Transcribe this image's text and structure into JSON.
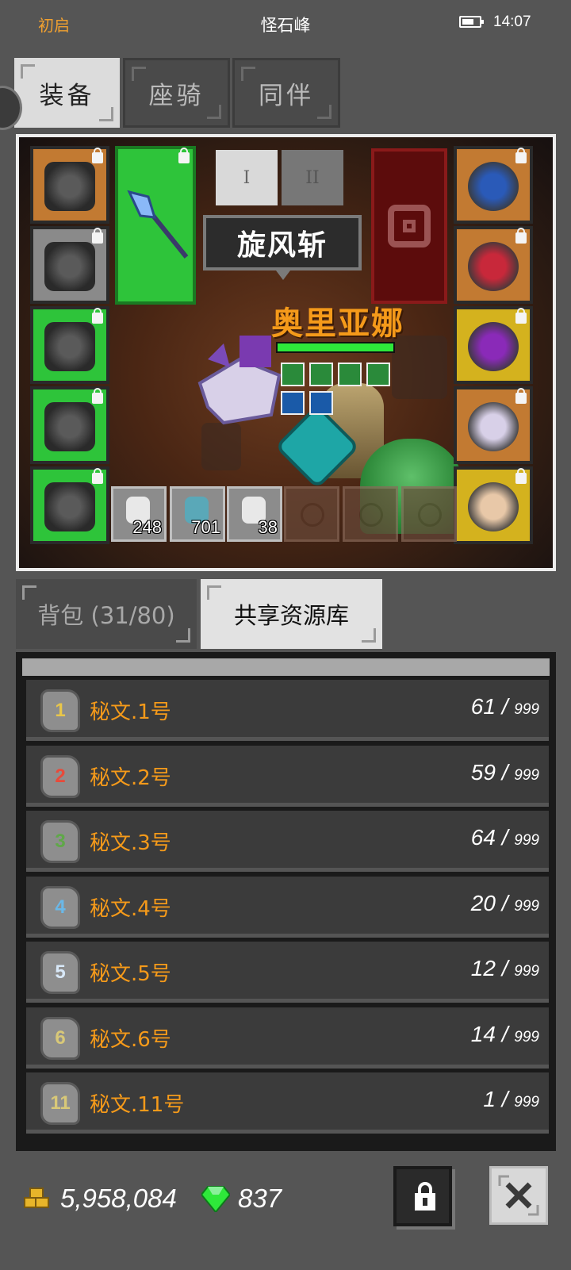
{
  "status_bar": {
    "left": "初启",
    "title": "怪石峰",
    "time": "14:07",
    "battery_level": 0.7
  },
  "tabs": [
    {
      "label": "装备",
      "active": true
    },
    {
      "label": "座骑",
      "active": false
    },
    {
      "label": "同伴",
      "active": false
    }
  ],
  "equipment": {
    "skill_tabs": [
      "I",
      "II"
    ],
    "skill_name": "旋风斩",
    "hero_name": "奥里亚娜",
    "hp_fraction": 1.0,
    "left_slots": [
      {
        "icon": "helmet-icon",
        "color": "#c27a32"
      },
      {
        "icon": "chest-armor-icon",
        "color": "#8a8a8a"
      },
      {
        "icon": "gauntlet-icon",
        "color": "#2ec43a"
      },
      {
        "icon": "boots-icon",
        "color": "#2ec43a"
      },
      {
        "icon": "belt-icon",
        "color": "#2ec43a"
      }
    ],
    "weapon": {
      "icon": "spear-icon",
      "color": "#2ec43a"
    },
    "relic": {
      "icon": "relic-ring-icon",
      "color": "#5c0c0c"
    },
    "right_slots": [
      {
        "icon": "amulet-icon",
        "color": "#c27a32"
      },
      {
        "icon": "ruby-ring-icon",
        "color": "#c27a32"
      },
      {
        "icon": "amethyst-ring-icon",
        "color": "#d4b21e"
      },
      {
        "icon": "unicorn-mount-icon",
        "color": "#c27a32"
      },
      {
        "icon": "cat-companion-icon",
        "color": "#d4b21e"
      }
    ],
    "consumables": [
      {
        "icon": "red-potion-icon",
        "count": "248"
      },
      {
        "icon": "fish-icon",
        "count": "701"
      },
      {
        "icon": "potion-icon",
        "count": "38"
      }
    ]
  },
  "bottom_tabs": [
    {
      "label": "背包 (31/80)",
      "active": false
    },
    {
      "label": "共享资源库",
      "active": true
    }
  ],
  "resources": [
    {
      "icon_label": "1",
      "icon_color": "#e8c64a",
      "name": "秘文.1号",
      "count": "61",
      "max": "999"
    },
    {
      "icon_label": "2",
      "icon_color": "#e84a3a",
      "name": "秘文.2号",
      "count": "59",
      "max": "999"
    },
    {
      "icon_label": "3",
      "icon_color": "#5fa848",
      "name": "秘文.3号",
      "count": "64",
      "max": "999"
    },
    {
      "icon_label": "4",
      "icon_color": "#6ab8e8",
      "name": "秘文.4号",
      "count": "20",
      "max": "999"
    },
    {
      "icon_label": "5",
      "icon_color": "#d8e8f8",
      "name": "秘文.5号",
      "count": "12",
      "max": "999"
    },
    {
      "icon_label": "6",
      "icon_color": "#d8c878",
      "name": "秘文.6号",
      "count": "14",
      "max": "999"
    },
    {
      "icon_label": "11",
      "icon_color": "#d8c878",
      "name": "秘文.11号",
      "count": "1",
      "max": "999"
    }
  ],
  "footer": {
    "gold": "5,958,084",
    "gems": "837"
  },
  "colors": {
    "accent_orange": "#f59a1a",
    "hp_green": "#2ee83a",
    "panel_bg": "#555555"
  }
}
